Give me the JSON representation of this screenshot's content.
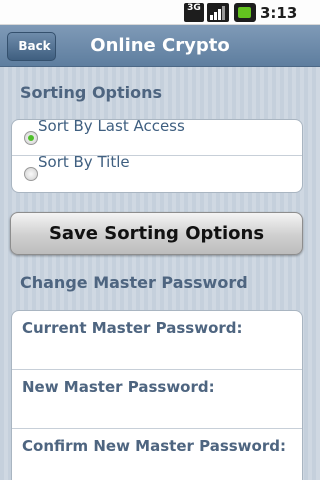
{
  "status_bar": {
    "network_label": "3G",
    "time": "3:13 AM",
    "icons": [
      "3g-icon",
      "signal-icon",
      "battery-icon"
    ]
  },
  "title_bar": {
    "back_label": "Back",
    "title": "Online Crypto"
  },
  "sorting": {
    "header": "Sorting Options",
    "options": [
      {
        "label": "Sort By Last Access",
        "checked": true
      },
      {
        "label": "Sort By Title",
        "checked": false
      }
    ],
    "save_label": "Save Sorting Options"
  },
  "password": {
    "header": "Change Master Password",
    "fields": [
      {
        "label": "Current Master Password:",
        "value": ""
      },
      {
        "label": "New Master Password:",
        "value": ""
      },
      {
        "label": "Confirm New Master Password:",
        "value": ""
      }
    ]
  },
  "colors": {
    "title_bar": "#6a88a8",
    "section_header": "#4e6580",
    "radio_checked": "#4fbf2a"
  }
}
